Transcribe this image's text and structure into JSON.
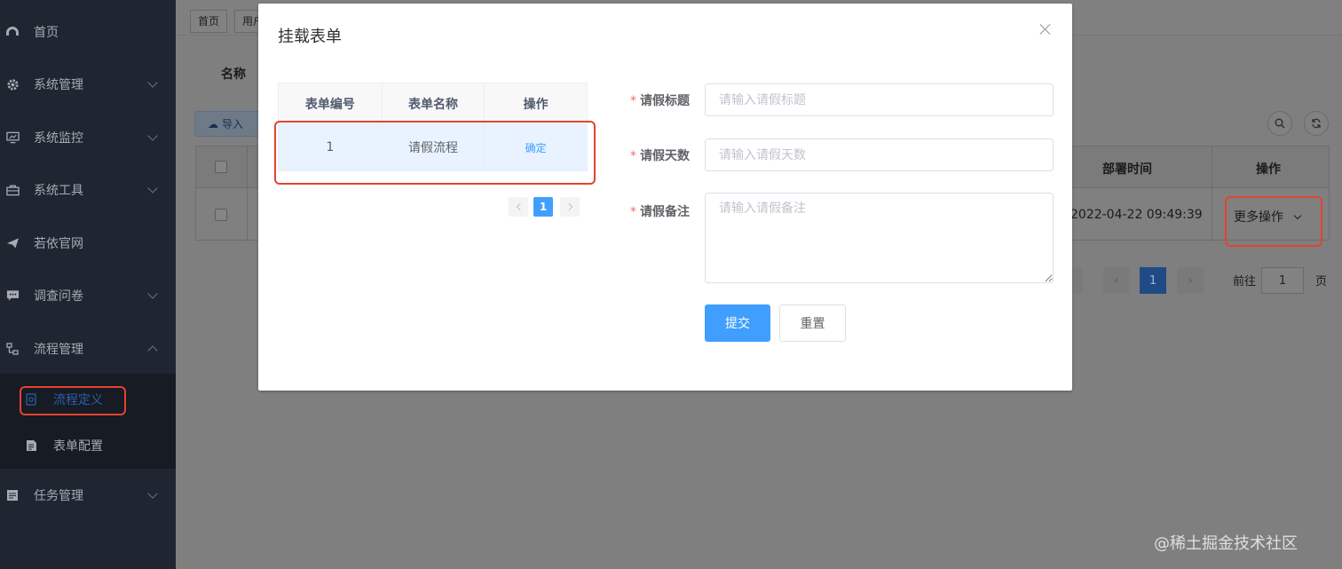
{
  "sidebar": {
    "items": [
      {
        "label": "首页",
        "icon": "dashboard-icon",
        "has_arrow": false
      },
      {
        "label": "系统管理",
        "icon": "gear-icon",
        "has_arrow": true
      },
      {
        "label": "系统监控",
        "icon": "monitor-icon",
        "has_arrow": true
      },
      {
        "label": "系统工具",
        "icon": "toolbox-icon",
        "has_arrow": true
      },
      {
        "label": "若依官网",
        "icon": "paper-plane-icon",
        "has_arrow": false
      },
      {
        "label": "调查问卷",
        "icon": "chat-icon",
        "has_arrow": true
      },
      {
        "label": "流程管理",
        "icon": "flow-tree-icon",
        "has_arrow": true,
        "expanded": true
      },
      {
        "label": "任务管理",
        "icon": "document-icon",
        "has_arrow": true
      }
    ],
    "submenu": [
      {
        "label": "流程定义",
        "icon": "process-icon",
        "active": true
      },
      {
        "label": "表单配置",
        "icon": "form-icon",
        "active": false
      }
    ],
    "active_color": "#2e5fa6"
  },
  "background": {
    "tags": [
      "首页",
      "用户"
    ],
    "filter_label": "名称",
    "import_label": "导入",
    "col_deploy_time": "部署时间",
    "col_actions": "操作",
    "row_deploy_time": "2022-04-22 09:49:39",
    "more_actions": "更多操作",
    "pager_page": "1",
    "goto_label": "前往",
    "goto_value": "1",
    "page_unit": "页"
  },
  "dialog": {
    "title": "挂载表单",
    "form_table": {
      "columns": [
        "表单编号",
        "表单名称",
        "操作"
      ],
      "rows": [
        {
          "id": "1",
          "name": "请假流程",
          "action": "确定"
        }
      ],
      "page": "1"
    },
    "form": {
      "fields": [
        {
          "label": "请假标题",
          "placeholder": "请输入请假标题",
          "required": true
        },
        {
          "label": "请假天数",
          "placeholder": "请输入请假天数",
          "required": true
        },
        {
          "label": "请假备注",
          "placeholder": "请输入请假备注",
          "required": true
        }
      ],
      "submit_label": "提交",
      "reset_label": "重置"
    }
  },
  "watermark": "@稀土掘金技术社区",
  "colors": {
    "primary": "#409eff",
    "highlight_red": "#e4432e",
    "sidebar_bg": "#1f2632",
    "required_star": "#f56c6c"
  }
}
